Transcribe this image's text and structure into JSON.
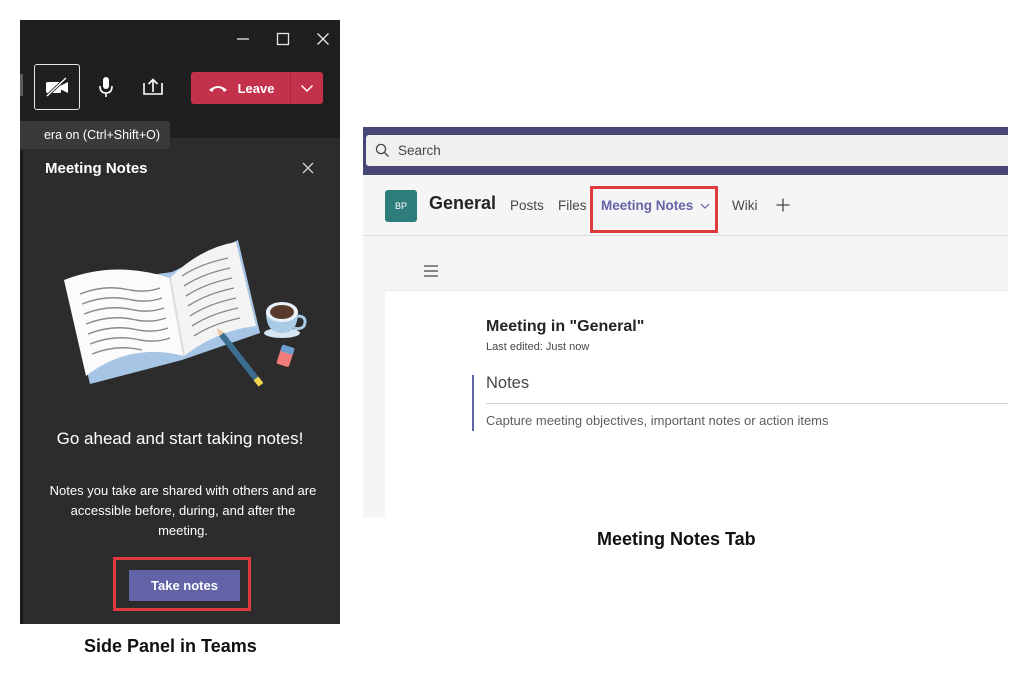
{
  "side_panel": {
    "tooltip": "era on (Ctrl+Shift+O)",
    "leave_label": "Leave",
    "title": "Meeting Notes",
    "heading": "Go ahead and start taking notes!",
    "body": "Notes you take are shared with others and are accessible before, during, and after the meeting.",
    "take_notes_label": "Take notes",
    "caption": "Side Panel in Teams"
  },
  "notes_tab": {
    "search_placeholder": "Search",
    "avatar_initials": "BP",
    "channel_name": "General",
    "tabs": [
      {
        "label": "Posts"
      },
      {
        "label": "Files"
      },
      {
        "label": "Meeting Notes",
        "active": true
      },
      {
        "label": "Wiki"
      }
    ],
    "doc_title": "Meeting in \"General\"",
    "last_edited": "Last edited: Just now",
    "notes_heading": "Notes",
    "notes_placeholder": "Capture meeting objectives, important notes or action items",
    "caption": "Meeting Notes Tab"
  },
  "colors": {
    "brand_purple": "#6264a7",
    "leave_red": "#c4314b",
    "highlight_red": "#e0393e",
    "dark_panel": "#2d2c2c"
  },
  "icons": [
    "minimize-icon",
    "maximize-icon",
    "close-icon",
    "camera-off-icon",
    "microphone-icon",
    "share-screen-icon",
    "hang-up-icon",
    "chevron-down-icon",
    "search-icon",
    "plus-icon",
    "hamburger-menu-icon"
  ]
}
